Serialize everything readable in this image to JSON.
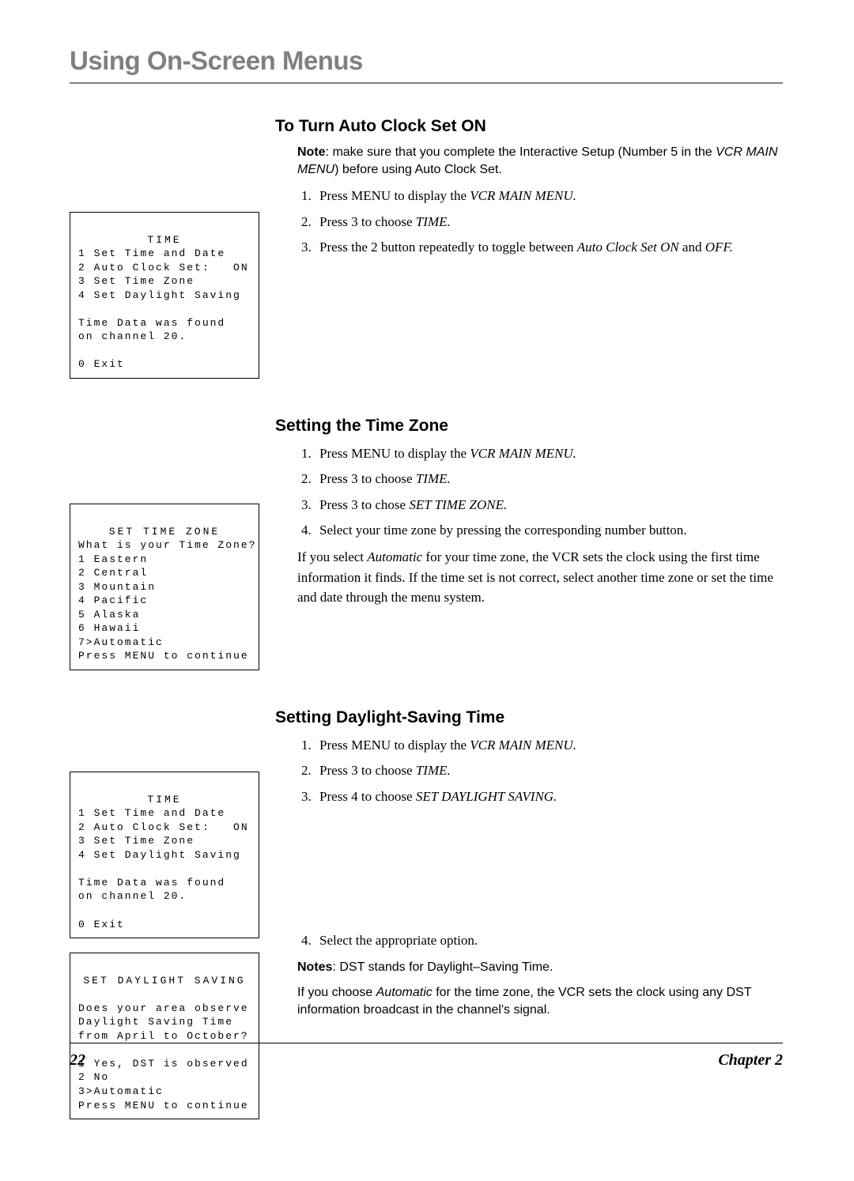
{
  "page_title": "Using On-Screen Menus",
  "section1": {
    "heading": "To Turn Auto Clock Set ON",
    "note_label": "Note",
    "note_text1": ": make sure that you complete the Interactive Setup (Number 5 in the ",
    "note_italic": "VCR MAIN MENU",
    "note_text2": ") before using Auto Clock Set.",
    "step1_a": "Press MENU to display the ",
    "step1_b": "VCR MAIN MENU.",
    "step2_a": "Press 3 to choose ",
    "step2_b": "TIME.",
    "step3_a": "Press the 2 button repeatedly to toggle between ",
    "step3_b": "Auto Clock Set ON",
    "step3_c": " and ",
    "step3_d": "OFF."
  },
  "menu1": {
    "title": "TIME",
    "l1": "1 Set Time and Date",
    "l2": "2 Auto Clock Set:   ON",
    "l3": "3 Set Time Zone",
    "l4": "4 Set Daylight Saving",
    "l5": "Time Data was found",
    "l6": "on channel 20.",
    "l7": "0 Exit"
  },
  "section2": {
    "heading": "Setting the Time Zone",
    "step1_a": "Press MENU to display the ",
    "step1_b": "VCR MAIN MENU.",
    "step2_a": "Press 3 to choose ",
    "step2_b": "TIME.",
    "step3_a": "Press 3 to chose ",
    "step3_b": "SET TIME ZONE.",
    "step4": "Select your time zone by pressing the corresponding number button.",
    "para_a": "If you select ",
    "para_b": "Automatic",
    "para_c": " for your time zone, the VCR sets the clock using the first time information it finds. If the time set is not correct, select another time zone or set the time and date through the menu system."
  },
  "menu2": {
    "title": "SET TIME ZONE",
    "l1": "What is your Time Zone?",
    "l2": "1 Eastern",
    "l3": "2 Central",
    "l4": "3 Mountain",
    "l5": "4 Pacific",
    "l6": "5 Alaska",
    "l7": "6 Hawaii",
    "l8": "7>Automatic",
    "l9": "Press MENU to continue"
  },
  "section3": {
    "heading": "Setting Daylight-Saving Time",
    "step1_a": "Press MENU to display the ",
    "step1_b": "VCR MAIN MENU.",
    "step2_a": "Press 3 to choose ",
    "step2_b": "TIME.",
    "step3_a": "Press 4 to choose ",
    "step3_b": "SET DAYLIGHT SAVING.",
    "step4": "Select the appropriate option.",
    "notes_label": "Notes",
    "notes_text": ": DST stands for Daylight–Saving Time.",
    "para2_a": "If you choose ",
    "para2_b": "Automatic",
    "para2_c": " for the time zone, the VCR sets the clock using any DST information broadcast in the channel's signal."
  },
  "menu3": {
    "title": "TIME",
    "l1": "1 Set Time and Date",
    "l2": "2 Auto Clock Set:   ON",
    "l3": "3 Set Time Zone",
    "l4": "4 Set Daylight Saving",
    "l5": "Time Data was found",
    "l6": "on channel 20.",
    "l7": "0 Exit"
  },
  "menu4": {
    "title": "SET DAYLIGHT SAVING",
    "l1": "Does your area observe",
    "l2": "Daylight Saving Time",
    "l3": "from April to October?",
    "l4": "1 Yes, DST is observed",
    "l5": "2 No",
    "l6": "3>Automatic",
    "l7": "Press MENU to continue"
  },
  "footer": {
    "page_number": "22",
    "chapter": "Chapter 2"
  }
}
